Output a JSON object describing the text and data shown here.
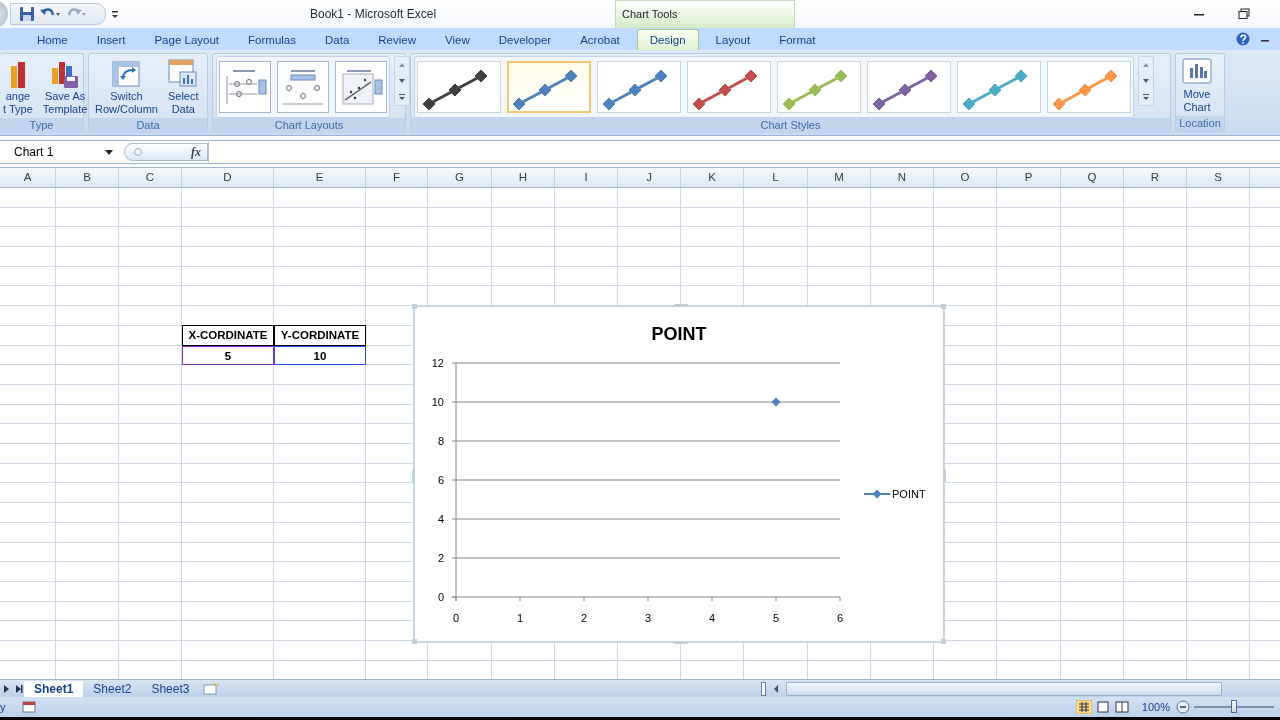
{
  "window": {
    "title": "Book1 - Microsoft Excel",
    "context_group": "Chart Tools"
  },
  "tabs": [
    {
      "label": "Home",
      "selected": false
    },
    {
      "label": "Insert",
      "selected": false
    },
    {
      "label": "Page Layout",
      "selected": false
    },
    {
      "label": "Formulas",
      "selected": false
    },
    {
      "label": "Data",
      "selected": false
    },
    {
      "label": "Review",
      "selected": false
    },
    {
      "label": "View",
      "selected": false
    },
    {
      "label": "Developer",
      "selected": false
    },
    {
      "label": "Acrobat",
      "selected": false
    },
    {
      "label": "Design",
      "selected": true
    },
    {
      "label": "Layout",
      "selected": false
    },
    {
      "label": "Format",
      "selected": false
    }
  ],
  "ribbon": {
    "type_group": {
      "label": "Type",
      "buttons": [
        {
          "label": "ange\nt Type",
          "kind": "chart-type"
        },
        {
          "label": "Save As\nTemplate",
          "kind": "template"
        }
      ]
    },
    "data_group": {
      "label": "Data",
      "buttons": [
        {
          "label": "Switch\nRow/Column",
          "kind": "switch"
        },
        {
          "label": "Select\nData",
          "kind": "select"
        }
      ]
    },
    "chart_layouts": {
      "label": "Chart Layouts",
      "items": [
        {
          "kind": "legend-right"
        },
        {
          "kind": "legend-top"
        },
        {
          "kind": "trendline"
        }
      ]
    },
    "chart_styles": {
      "label": "Chart Styles",
      "items": [
        {
          "color": "#404040",
          "selected": false
        },
        {
          "color": "#4f81bd",
          "selected": true
        },
        {
          "color": "#4f81bd",
          "selected": false
        },
        {
          "color": "#c0504d",
          "selected": false
        },
        {
          "color": "#9bbb59",
          "selected": false
        },
        {
          "color": "#8064a2",
          "selected": false
        },
        {
          "color": "#4bacc6",
          "selected": false
        },
        {
          "color": "#f79646",
          "selected": false
        }
      ]
    },
    "location_group": {
      "label": "Location",
      "button": "Move\nChart"
    }
  },
  "formula_bar": {
    "name_box": "Chart 1",
    "function_label": "fx"
  },
  "columns": [
    "A",
    "B",
    "C",
    "D",
    "E",
    "F",
    "G",
    "H",
    "I",
    "J",
    "K",
    "L",
    "M",
    "N",
    "O",
    "P",
    "Q",
    "R",
    "S"
  ],
  "data_table": {
    "headers": [
      "X-CORDINATE",
      "Y-CORDINATE"
    ],
    "rows": [
      {
        "cells": [
          "5",
          "10"
        ],
        "range_highlight": true
      }
    ]
  },
  "chart": {
    "chart_data": {
      "type": "scatter",
      "grid": true,
      "title": "POINT",
      "series": [
        {
          "name": "POINT",
          "color": "#4f81bd",
          "values": [
            10
          ]
        }
      ],
      "x": [
        5
      ],
      "xlim": [
        0,
        6
      ],
      "ylim": [
        0,
        12
      ],
      "xticks": [
        0,
        1,
        2,
        3,
        4,
        5,
        6
      ],
      "yticks": [
        0,
        2,
        4,
        6,
        8,
        10,
        12
      ]
    }
  },
  "sheet_tabs": [
    {
      "label": "Sheet1",
      "selected": true
    },
    {
      "label": "Sheet2",
      "selected": false
    },
    {
      "label": "Sheet3",
      "selected": false
    }
  ],
  "status_bar": {
    "text": "y",
    "zoom": "100%",
    "zoom_slider": {
      "level": 0.5
    }
  }
}
